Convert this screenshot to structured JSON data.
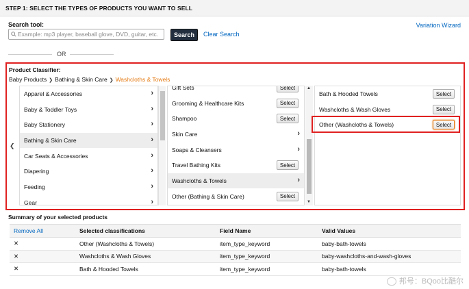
{
  "step_title": "STEP 1: SELECT THE TYPES OF PRODUCTS YOU WANT TO SELL",
  "search": {
    "label": "Search tool:",
    "placeholder": "Example: mp3 player, baseball glove, DVD, guitar, etc.",
    "value": "",
    "button": "Search",
    "clear": "Clear Search"
  },
  "wizard": "Variation Wizard",
  "or_text": "OR",
  "classifier": {
    "label": "Product Classifier:",
    "breadcrumb": [
      "Baby Products",
      "Bathing & Skin Care",
      "Washcloths & Towels"
    ],
    "col1": [
      {
        "label": "Apparel & Accessories"
      },
      {
        "label": "Baby & Toddler Toys"
      },
      {
        "label": "Baby Stationery"
      },
      {
        "label": "Bathing & Skin Care"
      },
      {
        "label": "Car Seats & Accessories"
      },
      {
        "label": "Diapering"
      },
      {
        "label": "Feeding"
      },
      {
        "label": "Gear"
      }
    ],
    "col2": [
      {
        "label": "Gift Sets",
        "action": "Select"
      },
      {
        "label": "Grooming & Healthcare Kits",
        "action": "Select"
      },
      {
        "label": "Shampoo",
        "action": "Select"
      },
      {
        "label": "Skin Care"
      },
      {
        "label": "Soaps & Cleansers"
      },
      {
        "label": "Travel Bathing Kits",
        "action": "Select"
      },
      {
        "label": "Washcloths & Towels"
      },
      {
        "label": "Other (Bathing & Skin Care)",
        "action": "Select"
      }
    ],
    "col3": [
      {
        "label": "Bath & Hooded Towels",
        "action": "Select"
      },
      {
        "label": "Washcloths & Wash Gloves",
        "action": "Select"
      },
      {
        "label": "Other (Washcloths & Towels)",
        "action": "Select"
      }
    ]
  },
  "summary": {
    "title": "Summary of your selected products",
    "headers": [
      "Remove All",
      "Selected classifications",
      "Field Name",
      "Valid Values"
    ],
    "rows": [
      {
        "remove": "✕",
        "classification": "Other (Washcloths & Towels)",
        "field": "item_type_keyword",
        "value": "baby-bath-towels"
      },
      {
        "remove": "✕",
        "classification": "Washcloths & Wash Gloves",
        "field": "item_type_keyword",
        "value": "baby-washcloths-and-wash-gloves"
      },
      {
        "remove": "✕",
        "classification": "Bath & Hooded Towels",
        "field": "item_type_keyword",
        "value": "baby-bath-towels"
      }
    ]
  },
  "watermark": "邦号：BQoo比酷尔"
}
